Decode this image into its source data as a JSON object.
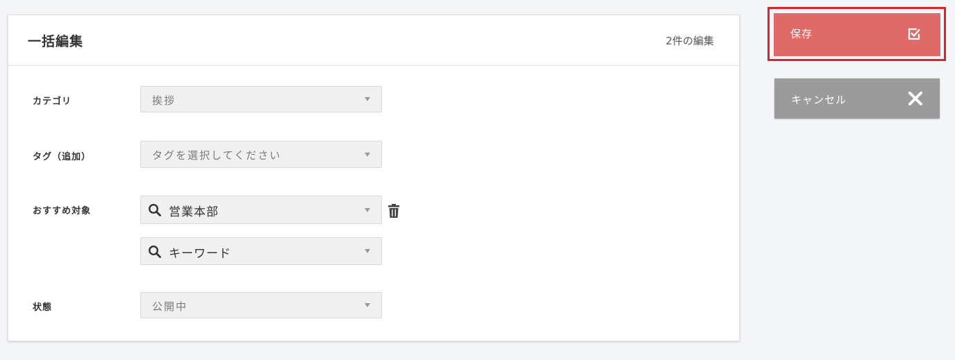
{
  "card": {
    "title": "一括編集",
    "edit_count": "2件の編集"
  },
  "fields": {
    "category": {
      "label": "カテゴリ",
      "value": "挨拶"
    },
    "tags": {
      "label": "タグ（追加）",
      "placeholder": "タグを選択してください"
    },
    "recommend": {
      "label": "おすすめ対象",
      "value1": "営業本部",
      "value2": "キーワード"
    },
    "status": {
      "label": "状態",
      "value": "公開中"
    }
  },
  "actions": {
    "save_label": "保存",
    "cancel_label": "キャンセル"
  },
  "colors": {
    "save_bg": "#e06969",
    "save_highlight": "#e0202a",
    "cancel_bg": "#9b9b9b"
  },
  "icons": {
    "search": "search-icon",
    "trash": "trash-icon",
    "save": "checkbox-check-icon",
    "cancel": "close-icon",
    "dropdown": "chevron-down-icon"
  }
}
